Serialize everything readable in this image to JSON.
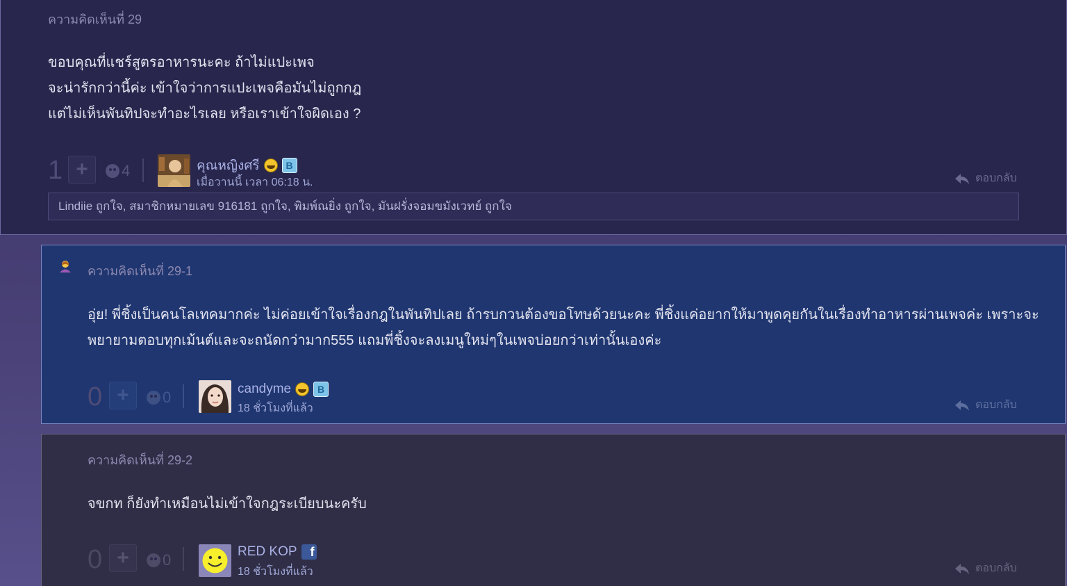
{
  "comments": [
    {
      "label": "ความคิดเห็นที่ 29",
      "body_lines": [
        "ขอบคุณที่แชร์สูตรอาหารนะคะ ถ้าไม่แปะเพจ",
        "จะน่ารักกว่านี้ค่ะ เข้าใจว่าการแปะเพจคือมันไม่ถูกกฎ",
        "แต่ไม่เห็นพันทิปจะทำอะไรเลย หรือเราเข้าใจผิดเอง ?"
      ],
      "vote_count": "1",
      "emotion_count": "4",
      "username": "คุณหญิงศรี",
      "time": "เมื่อวานนี้ เวลา 06:18 น.",
      "reply_label": "ตอบกลับ",
      "likes_text": "Lindiie ถูกใจ, สมาชิกหมายเลข 916181 ถูกใจ, พิมพ์ณยิ่ง ถูกใจ, มันฝรั่งจอมขมังเวทย์ ถูกใจ"
    },
    {
      "label": "ความคิดเห็นที่ 29-1",
      "body_lines": [
        "อุ่ย! พี่ชิ้งเป็นคนโลเทคมากค่ะ ไม่ค่อยเข้าใจเรื่องกฎในพันทิปเลย ถ้ารบกวนต้องขอโทษด้วยนะคะ พี่ชิ้งแค่อยากให้มาพูดคุยกันในเรื่องทำอาหารผ่านเพจค่ะ เพราะจะ",
        "พยายามตอบทุกเม้นต์และจะถนัดกว่ามาก555 แถมพี่ชิ้งจะลงเมนูใหม่ๆในเพจบ่อยกว่าเท่านั้นเองค่ะ"
      ],
      "vote_count": "0",
      "emotion_count": "0",
      "username": "candyme",
      "time": "18 ชั่วโมงที่แล้ว",
      "reply_label": "ตอบกลับ"
    },
    {
      "label": "ความคิดเห็นที่ 29-2",
      "body_lines": [
        "จขกท ก็ยังทำเหมือนไม่เข้าใจกฎระเบียบนะครับ"
      ],
      "vote_count": "0",
      "emotion_count": "0",
      "username": "RED KOP",
      "time": "18 ชั่วโมงที่แล้ว",
      "reply_label": "ตอบกลับ"
    }
  ],
  "icons": {
    "plus": "plus-icon",
    "emotion": "emotion-face-icon",
    "reply": "reply-arrow-icon",
    "smile_badge": "smile-badge-icon",
    "blog_badge": "blog-badge-icon",
    "facebook_badge": "facebook-icon",
    "author_icon": "author-person-icon"
  },
  "colors": {
    "comment_bg": "#28264d",
    "reply_owner_bg": "#1f3670",
    "reply_bg": "#302e47",
    "label": "#8d89b0",
    "username": "#aab2e6"
  }
}
